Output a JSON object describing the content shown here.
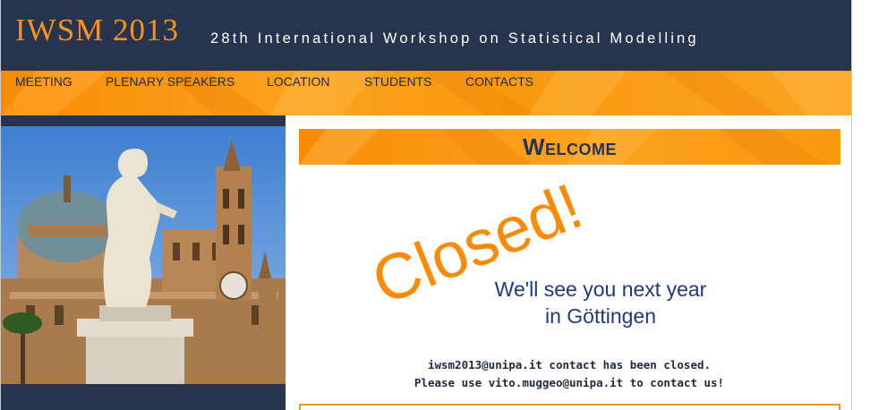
{
  "header": {
    "title": "IWSM 2013",
    "subtitle": "28th International Workshop on Statistical Modelling"
  },
  "nav": {
    "items": [
      {
        "label": "MEETING"
      },
      {
        "label": "PLENARY SPEAKERS"
      },
      {
        "label": "LOCATION"
      },
      {
        "label": "STUDENTS"
      },
      {
        "label": "CONTACTS"
      }
    ]
  },
  "main": {
    "welcome_title": "Welcome",
    "closed_text": "Closed!",
    "see_you_line1": "We'll see you next year",
    "see_you_line2": "in Göttingen",
    "notice_line1": "iwsm2013@unipa.it contact has been closed.",
    "notice_line2": "Please use vito.muggeo@unipa.it to contact us!"
  },
  "colors": {
    "header_bg": "#27344d",
    "accent_orange": "#f7941d",
    "closed_text": "#f98b06",
    "message_blue": "#1f3a7a"
  }
}
